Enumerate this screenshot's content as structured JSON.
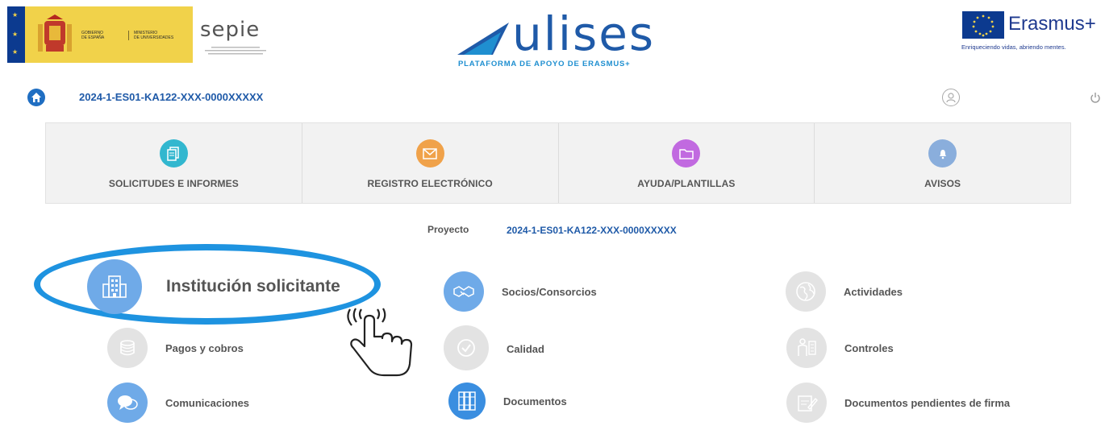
{
  "header": {
    "gov_line1": "GOBIERNO",
    "gov_line2": "DE ESPAÑA",
    "ministry_line1": "MINISTERIO",
    "ministry_line2": "DE UNIVERSIDADES",
    "sepie_word": "sepie",
    "ulises_word": "ulises",
    "ulises_subtitle": "PLATAFORMA DE APOYO DE ERASMUS+",
    "erasmus_word": "Erasmus+",
    "erasmus_tagline": "Enriqueciendo vidas, abriendo mentes."
  },
  "nav": {
    "project_code": "2024-1-ES01-KA122-XXX-0000XXXXX"
  },
  "tabs": [
    {
      "label": "SOLICITUDES E INFORMES",
      "icon": "documents-icon",
      "color": "#32b7cf"
    },
    {
      "label": "REGISTRO ELECTRÓNICO",
      "icon": "mail-icon",
      "color": "#f0a24a"
    },
    {
      "label": "AYUDA/PLANTILLAS",
      "icon": "folder-icon",
      "color": "#c16ae0"
    },
    {
      "label": "AVISOS",
      "icon": "bell-icon",
      "color": "#8aaedc"
    }
  ],
  "project": {
    "label": "Proyecto",
    "code": "2024-1-ES01-KA122-XXX-0000XXXXX"
  },
  "menu": {
    "institucion": "Institución solicitante",
    "socios": "Socios/Consorcios",
    "actividades": "Actividades",
    "pagos": "Pagos y cobros",
    "calidad": "Calidad",
    "controles": "Controles",
    "comunicaciones": "Comunicaciones",
    "documentos": "Documentos",
    "pendientes": "Documentos pendientes de firma"
  },
  "colors": {
    "accent_blue": "#1f5aa8",
    "highlight_ring": "#1e93e0",
    "active_icon": "#6faae8",
    "inactive_icon": "#e3e3e3"
  }
}
